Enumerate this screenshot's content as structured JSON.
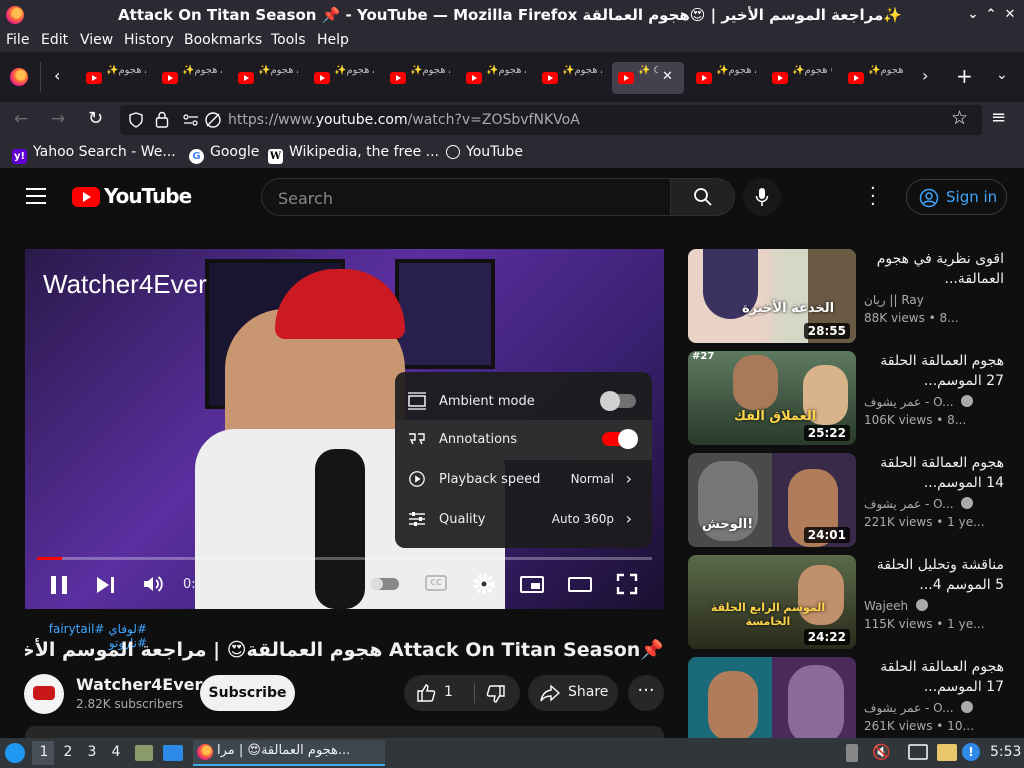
{
  "window": {
    "title": "Attack On Titan Season 📌 - YouTube — Mozilla Firefox مراجعة الموسم الأخير | 😍هجوم العمالقة✨",
    "controls": [
      "⌄",
      "⌃",
      "✕"
    ]
  },
  "menu": [
    "File",
    "Edit",
    "View",
    "History",
    "Bookmarks",
    "Tools",
    "Help"
  ],
  "tabs": [
    {
      "label": "✨هجوم AYING"
    },
    {
      "label": "✨هجوم AYING"
    },
    {
      "label": "✨هجوم AYING"
    },
    {
      "label": "✨هجوم AYING"
    },
    {
      "label": "✨هجوم AYING"
    },
    {
      "label": "✨هجوم AYING"
    },
    {
      "label": "✨هجوم AYING"
    },
    {
      "label": "✨ G"
    },
    {
      "label": "✨هجوم AYING"
    },
    {
      "label": "✨هجوم CKED"
    },
    {
      "label": "✨هجوم"
    }
  ],
  "nav": {
    "url_prefix": "https://www.",
    "url_domain": "youtube.com",
    "url_path": "/watch?v=ZOSbvfNKVoA"
  },
  "bookmarks": [
    {
      "label": "Yahoo Search - We...",
      "icon": "y!"
    },
    {
      "label": "Google",
      "icon": "G"
    },
    {
      "label": "Wikipedia, the free ...",
      "icon": "W"
    },
    {
      "label": "YouTube",
      "icon": "globe"
    }
  ],
  "youtube": {
    "logo": "YouTube",
    "search_placeholder": "Search",
    "sign_in": "Sign in",
    "video": {
      "watermark": "Watcher4Ever",
      "time": "0:04 / 18:20",
      "progress": 0.004,
      "settings": {
        "ambient_mode": "Ambient mode",
        "ambient_on": false,
        "annotations": "Annotations",
        "annotations_on": true,
        "playback_speed": "Playback speed",
        "playback_value": "Normal",
        "quality": "Quality",
        "quality_value": "Auto 360p"
      }
    },
    "hashtags": "#لوفاي #fairytail #ناروتو",
    "title": "📌Attack On Titan Season هجوم العمالقة😍 | مراجعة الموسم الأخير✨",
    "channel": "Watcher4Ever",
    "subscribers": "2.82K subscribers",
    "subscribe": "Subscribe",
    "likes": "1",
    "share": "Share",
    "related": [
      {
        "title": "اقوى نظرية في هجوم العمالقة...",
        "channel": "ريان || Ray",
        "meta": "88K views • 8...",
        "duration": "28:55",
        "thumb_text": "الخدعة الأخيرة",
        "verified": false
      },
      {
        "title": "هجوم العمالقة الحلقة 27 الموسم...",
        "channel": "عمر يشوف - O...",
        "meta": "106K views • 8...",
        "duration": "25:22",
        "thumb_text": "العملاق الفك",
        "verified": true
      },
      {
        "title": "هجوم العمالقة الحلقة 14 الموسم...",
        "channel": "عمر يشوف - O...",
        "meta": "221K views • 1 ye...",
        "duration": "24:01",
        "thumb_text": "الوحش!",
        "verified": true
      },
      {
        "title": "مناقشة وتحليل الحلقة 5 الموسم 4...",
        "channel": "Wajeeh",
        "meta": "115K views • 1 ye...",
        "duration": "24:22",
        "thumb_text": "الموسم الرابع الحلقة الخامسة",
        "verified": true
      },
      {
        "title": "هجوم العمالقة الحلقة 17 الموسم...",
        "channel": "عمر يشوف - O...",
        "meta": "261K views • 10...",
        "duration": "",
        "thumb_text": "",
        "verified": true
      }
    ]
  },
  "taskbar": {
    "workspaces": [
      "1",
      "2",
      "3",
      "4"
    ],
    "task_label": "هجوم العمالقة😍 | مرا...",
    "clock": "5:53"
  }
}
